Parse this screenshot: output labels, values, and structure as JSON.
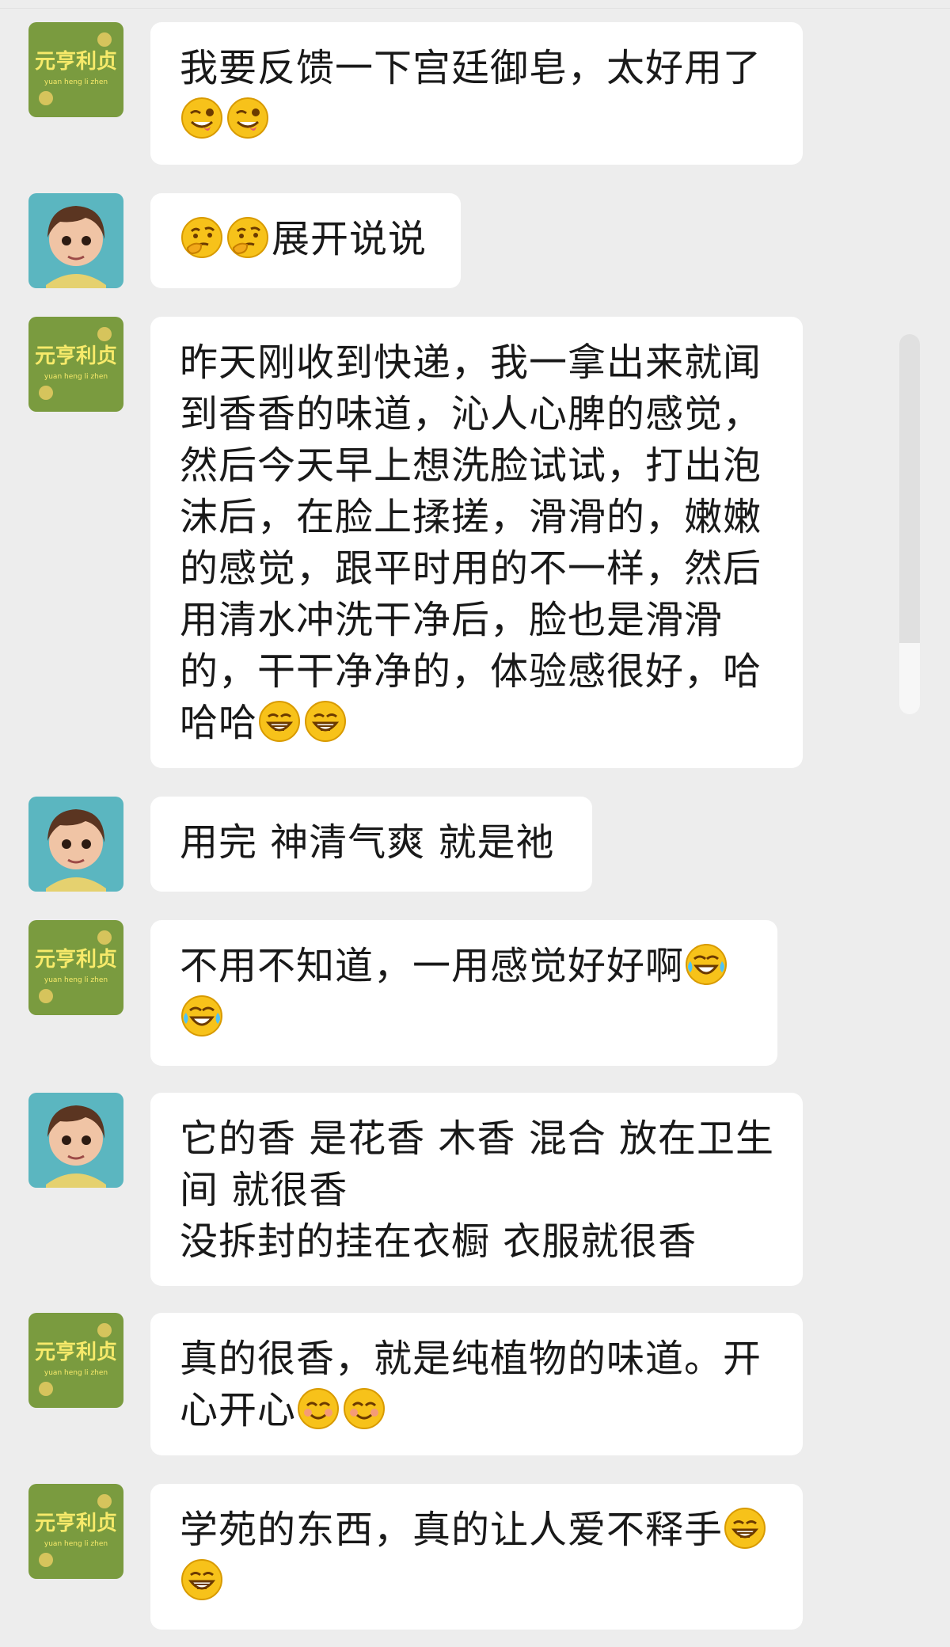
{
  "conversation": {
    "messages": [
      {
        "sender": "brand-account",
        "avatar_icon": "brand-logo-avatar-icon",
        "avatar_label": "元亨利贞",
        "avatar_sublabel": "yuan heng li zhen",
        "lines": [
          "我要反馈一下宫廷御皂，太好用了",
          "😜😜"
        ]
      },
      {
        "sender": "girl-avatar-user",
        "avatar_icon": "cartoon-girl-avatar-icon",
        "lines": [
          "🤔🤔展开说说"
        ]
      },
      {
        "sender": "brand-account",
        "avatar_icon": "brand-logo-avatar-icon",
        "avatar_label": "元亨利贞",
        "avatar_sublabel": "yuan heng li zhen",
        "lines": [
          "昨天刚收到快递，我一拿出来就闻",
          "到香香的味道，沁人心脾的感觉，",
          "然后今天早上想洗脸试试，打出泡",
          "沫后，在脸上揉搓，滑滑的，嫩嫩",
          "的感觉，跟平时用的不一样，然后",
          "用清水冲洗干净后，脸也是滑滑",
          "的，干干净净的，体验感很好，哈",
          "哈哈😁😁"
        ]
      },
      {
        "sender": "girl-avatar-user",
        "avatar_icon": "cartoon-girl-avatar-icon",
        "lines": [
          "用完 神清气爽 就是祂"
        ]
      },
      {
        "sender": "brand-account",
        "avatar_icon": "brand-logo-avatar-icon",
        "avatar_label": "元亨利贞",
        "avatar_sublabel": "yuan heng li zhen",
        "lines": [
          "不用不知道，一用感觉好好啊😂",
          "😂"
        ]
      },
      {
        "sender": "girl-avatar-user",
        "avatar_icon": "cartoon-girl-avatar-icon",
        "lines": [
          "它的香 是花香 木香 混合 放在卫生",
          "间 就很香",
          "没拆封的挂在衣橱 衣服就很香"
        ]
      },
      {
        "sender": "brand-account",
        "avatar_icon": "brand-logo-avatar-icon",
        "avatar_label": "元亨利贞",
        "avatar_sublabel": "yuan heng li zhen",
        "lines": [
          "真的很香，就是纯植物的味道。开",
          "心开心😊😊"
        ]
      },
      {
        "sender": "brand-account",
        "avatar_icon": "brand-logo-avatar-icon",
        "avatar_label": "元亨利贞",
        "avatar_sublabel": "yuan heng li zhen",
        "lines": [
          "学苑的东西，真的让人爱不释手😁",
          "😁"
        ]
      }
    ]
  },
  "colors": {
    "background": "#ededed",
    "bubble": "#ffffff",
    "text": "#191919",
    "brand_avatar_bg": "#7a9b3f",
    "brand_avatar_text": "#f7ea6a",
    "girl_avatar_bg": "#5bb6c0"
  },
  "emoji_icons": {
    "😜": "winking-tongue-emoji-icon",
    "🤔": "thinking-emoji-icon",
    "😁": "grinning-emoji-icon",
    "😂": "tears-of-joy-emoji-icon",
    "😊": "smiling-emoji-icon"
  }
}
